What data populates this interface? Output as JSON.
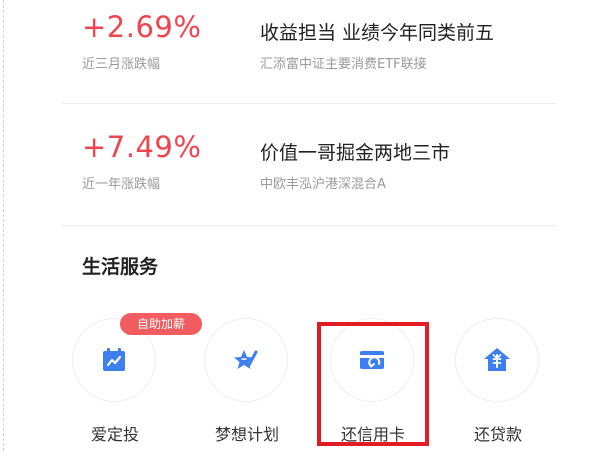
{
  "funds": [
    {
      "rate": "+2.69%",
      "rate_label": "近三月涨跌幅",
      "title": "收益担当 业绩今年同类前五",
      "name": "汇添富中证主要消费ETF联接"
    },
    {
      "rate": "+7.49%",
      "rate_label": "近一年涨跌幅",
      "title": "价值一哥掘金两地三市",
      "name": "中欧丰泓沪港深混合A"
    }
  ],
  "life_services": {
    "title": "生活服务",
    "badge": "自助加薪",
    "items": [
      {
        "label": "爱定投",
        "icon": "calendar-auto-invest-icon"
      },
      {
        "label": "梦想计划",
        "icon": "star-dream-icon"
      },
      {
        "label": "还信用卡",
        "icon": "credit-card-repay-icon"
      },
      {
        "label": "还贷款",
        "icon": "house-loan-icon"
      }
    ]
  },
  "colors": {
    "accent_red": "#f0454f",
    "icon_blue": "#3d7ff0",
    "highlight_red": "#e21b24",
    "badge_red": "#f25b5f"
  }
}
